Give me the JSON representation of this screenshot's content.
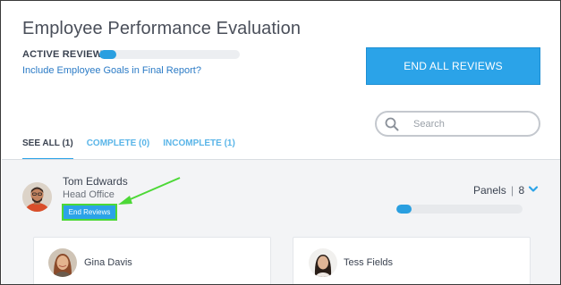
{
  "header": {
    "title": "Employee Performance Evaluation",
    "active_review_label": "ACTIVE REVIEW",
    "active_review_progress": 0.12,
    "goals_link": "Include Employee Goals in Final Report?",
    "end_all_label": "END ALL REVIEWS"
  },
  "search": {
    "placeholder": "Search"
  },
  "tabs": [
    {
      "label": "SEE ALL (1)",
      "active": true
    },
    {
      "label": "COMPLETE (0)",
      "active": false
    },
    {
      "label": "INCOMPLETE (1)",
      "active": false
    }
  ],
  "employee": {
    "name": "Tom Edwards",
    "location": "Head Office",
    "end_reviews_label": "End Reviews",
    "panels_label": "Panels",
    "panels_count": "8",
    "panel_progress": 0.12
  },
  "reviewers": [
    {
      "name": "Gina Davis"
    },
    {
      "name": "Tess Fields"
    }
  ],
  "colors": {
    "accent": "#2ba3e8",
    "highlight": "#4cd836",
    "link": "#2b7bc6"
  }
}
